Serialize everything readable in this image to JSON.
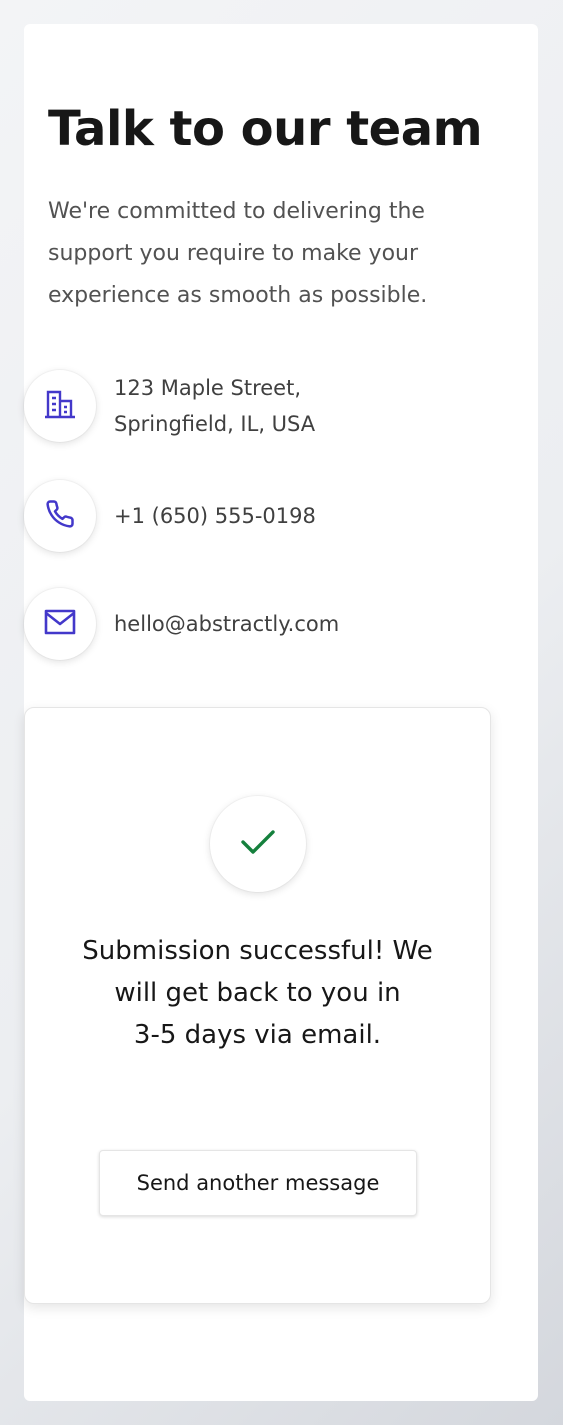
{
  "header": {
    "title": "Talk to our team",
    "subtitle": "We're committed to delivering the\nsupport you require to make your\nexperience as smooth as possible."
  },
  "contacts": [
    {
      "icon": "building-icon",
      "text": "123 Maple Street,\nSpringfield, IL, USA"
    },
    {
      "icon": "phone-icon",
      "text": "+1 (650) 555-0198"
    },
    {
      "icon": "mail-icon",
      "text": "hello@abstractly.com"
    }
  ],
  "success": {
    "icon": "check-icon",
    "message": "Submission successful! We\nwill get back to you in\n3-5 days via email.",
    "button_label": "Send another message"
  },
  "colors": {
    "accent": "#4338ca",
    "success": "#15803d",
    "heading": "#171717",
    "body_text": "#525252"
  }
}
